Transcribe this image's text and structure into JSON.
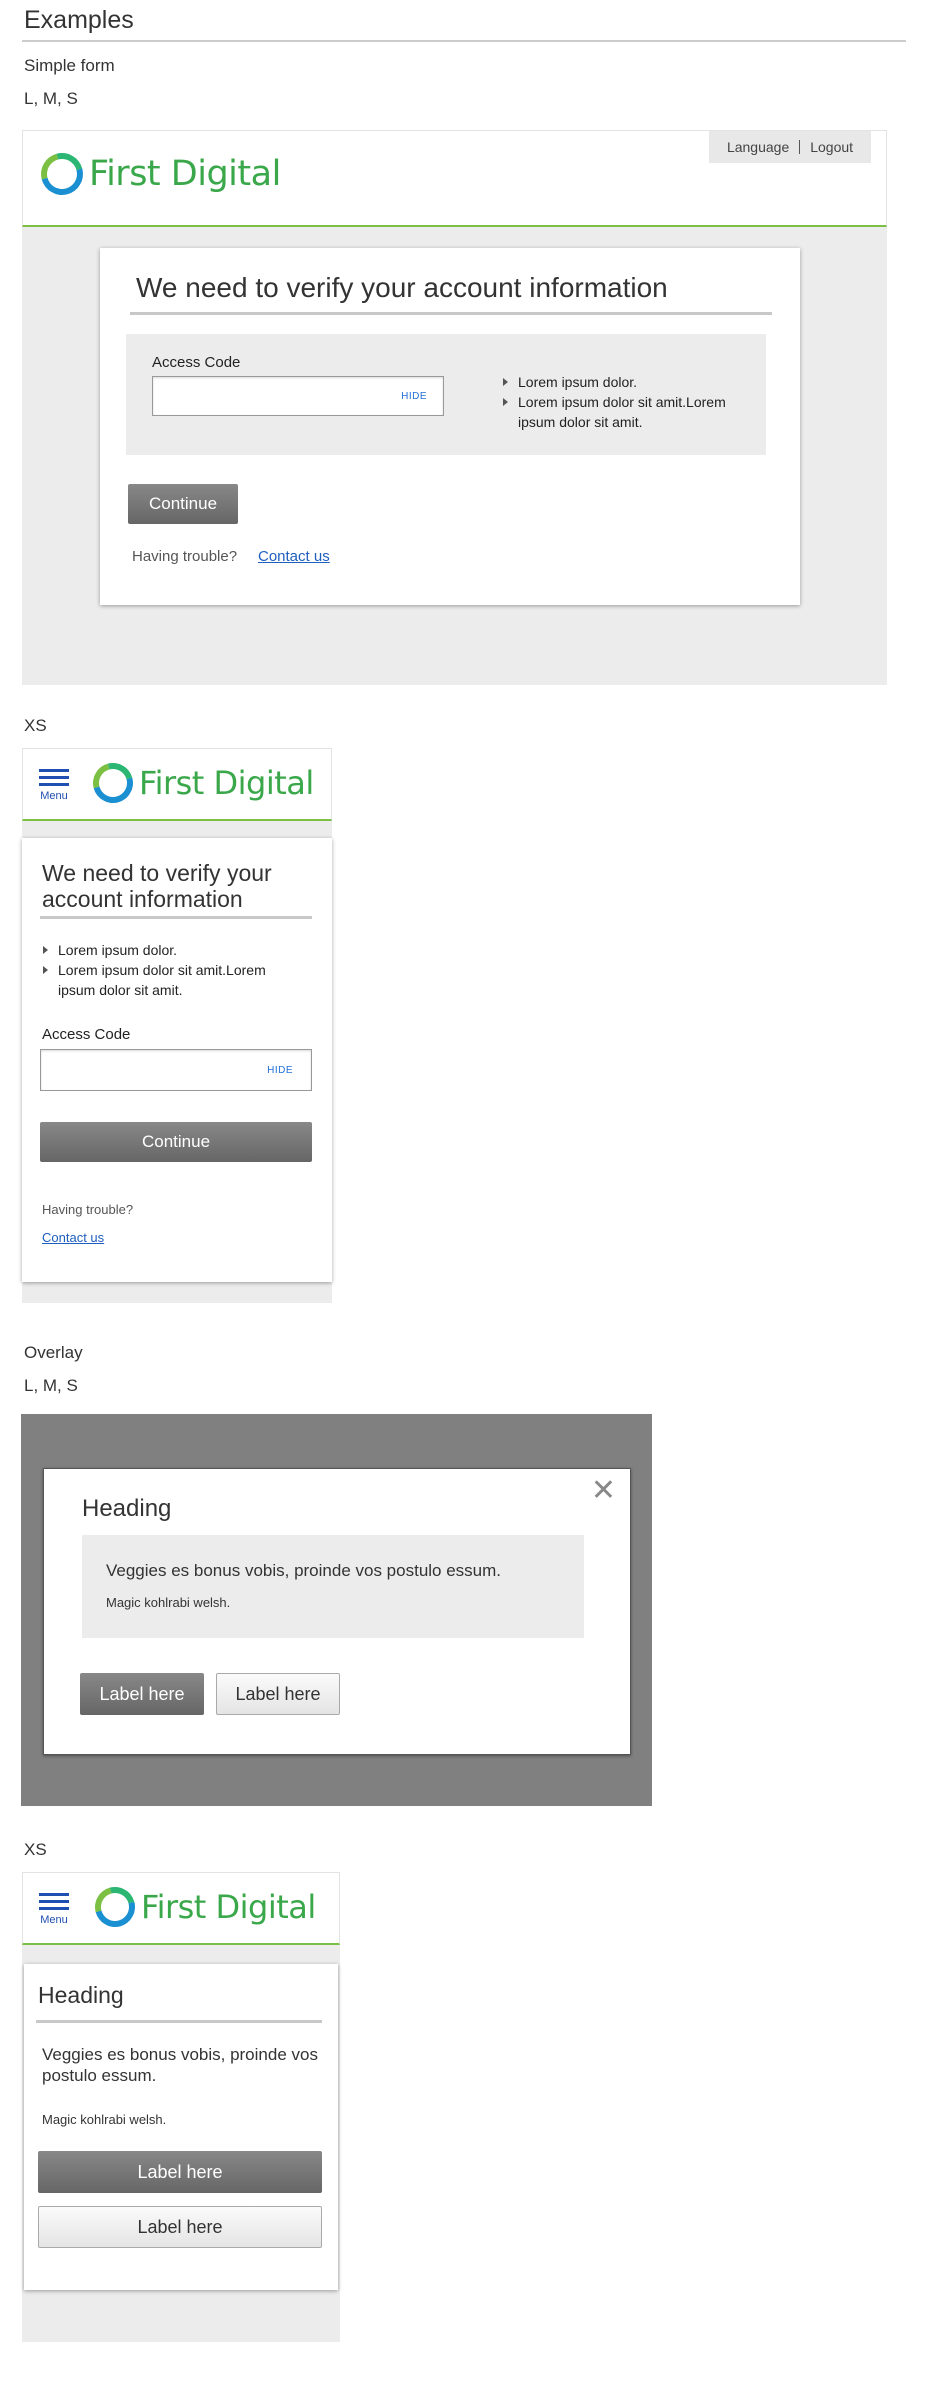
{
  "page": {
    "title": "Examples",
    "simple_form": "Simple form",
    "sizes_lms": "L, M, S",
    "xs": "XS",
    "overlay": "Overlay"
  },
  "brand": {
    "name": "First Digital",
    "menu": "Menu",
    "language": "Language",
    "logout": "Logout"
  },
  "form": {
    "heading": "We need to verify your account information",
    "access_label": "Access Code",
    "access_value": "",
    "hide": "HIDE",
    "bullets": [
      "Lorem ipsum dolor.",
      "Lorem ipsum dolor sit amit.Lorem ipsum dolor sit amit."
    ],
    "continue": "Continue",
    "trouble": "Having trouble?",
    "contact": "Contact us"
  },
  "overlay": {
    "heading": "Heading",
    "lead": "Veggies es bonus vobis, proinde vos postulo essum.",
    "sub": "Magic kohlrabi welsh.",
    "primary": "Label here",
    "secondary": "Label here",
    "close": "✕"
  },
  "colors": {
    "brand_green": "#3aa84a",
    "header_rule": "#7bbf44",
    "link_blue": "#1f5fbf",
    "overlay_dim": "#808080"
  }
}
